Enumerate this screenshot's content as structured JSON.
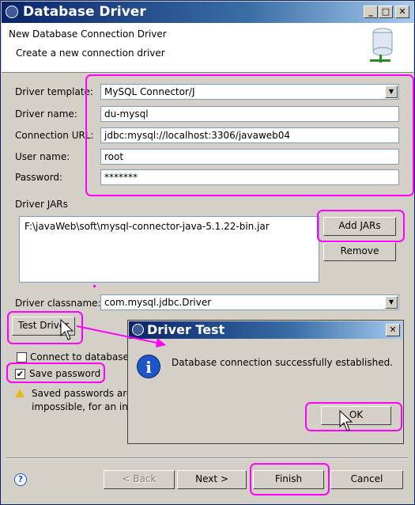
{
  "window": {
    "title": "Database Driver",
    "min_glyph": "_",
    "max_glyph": "□",
    "close_glyph": "✕"
  },
  "header": {
    "title": "New Database Connection Driver",
    "subtitle": "Create a new connection driver"
  },
  "form": {
    "driver_template_label": "Driver template:",
    "driver_template_value": "MySQL Connector/J",
    "driver_name_label": "Driver name:",
    "driver_name_value": "du-mysql",
    "connection_url_label": "Connection URL:",
    "connection_url_value": "jdbc:mysql://localhost:3306/javaweb04",
    "user_name_label": "User name:",
    "user_name_value": "root",
    "password_label": "Password:",
    "password_value": "*******"
  },
  "jars": {
    "label": "Driver JARs",
    "items": [
      "F:\\javaWeb\\soft\\mysql-connector-java-5.1.22-bin.jar"
    ],
    "add_label": "Add JARs",
    "remove_label": "Remove"
  },
  "classname": {
    "label": "Driver classname:",
    "value": "com.mysql.jdbc.Driver"
  },
  "test_driver_label": "Test Driver",
  "connect_label": "Connect to database",
  "connect_checked": false,
  "save_password_label": "Save password",
  "save_password_checked": true,
  "warning_line1": "Saved passwords are",
  "warning_line2": "impossible, for an int",
  "footer": {
    "help": "?",
    "back": "< Back",
    "next": "Next >",
    "finish": "Finish",
    "cancel": "Cancel"
  },
  "dialog": {
    "title": "Driver Test",
    "message": "Database connection successfully established.",
    "ok": "OK",
    "info_glyph": "i",
    "close_glyph": "✕"
  },
  "colors": {
    "highlight": "#ff00ff",
    "titlebar": "#0a246a"
  }
}
